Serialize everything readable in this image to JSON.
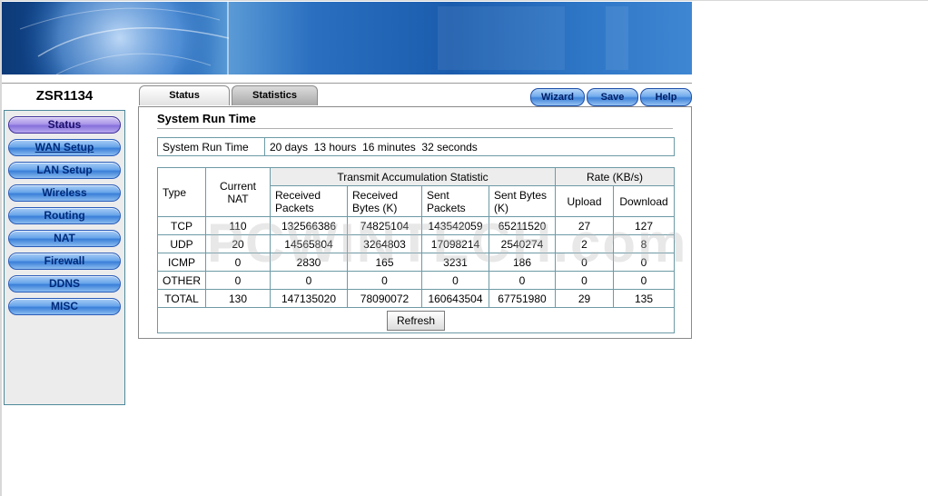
{
  "device_name": "ZSR1134",
  "sidebar": {
    "items": [
      {
        "label": "Status"
      },
      {
        "label": "WAN Setup"
      },
      {
        "label": "LAN Setup"
      },
      {
        "label": "Wireless"
      },
      {
        "label": "Routing"
      },
      {
        "label": "NAT"
      },
      {
        "label": "Firewall"
      },
      {
        "label": "DDNS"
      },
      {
        "label": "MISC"
      }
    ]
  },
  "tabs": [
    {
      "label": "Status"
    },
    {
      "label": "Statistics"
    }
  ],
  "actions": {
    "wizard": "Wizard",
    "save": "Save",
    "help": "Help"
  },
  "panel": {
    "title": "System Run Time",
    "run_time_label": "System Run Time",
    "run_time_value": "20 days  13 hours  16 minutes  32 seconds"
  },
  "stats": {
    "headers": {
      "type": "Type",
      "current_nat": "Current NAT",
      "transmit": "Transmit Accumulation Statistic",
      "rate": "Rate (KB/s)",
      "received_packets": "Received Packets",
      "received_bytes": "Received Bytes (K)",
      "sent_packets": "Sent Packets",
      "sent_bytes": "Sent Bytes (K)",
      "upload": "Upload",
      "download": "Download"
    },
    "rows": [
      {
        "type": "TCP",
        "nat": "110",
        "rx_pkts": "132566386",
        "rx_bytes": "74825104",
        "tx_pkts": "143542059",
        "tx_bytes": "65211520",
        "upload": "27",
        "download": "127"
      },
      {
        "type": "UDP",
        "nat": "20",
        "rx_pkts": "14565804",
        "rx_bytes": "3264803",
        "tx_pkts": "17098214",
        "tx_bytes": "2540274",
        "upload": "2",
        "download": "8"
      },
      {
        "type": "ICMP",
        "nat": "0",
        "rx_pkts": "2830",
        "rx_bytes": "165",
        "tx_pkts": "3231",
        "tx_bytes": "186",
        "upload": "0",
        "download": "0"
      },
      {
        "type": "OTHER",
        "nat": "0",
        "rx_pkts": "0",
        "rx_bytes": "0",
        "tx_pkts": "0",
        "tx_bytes": "0",
        "upload": "0",
        "download": "0"
      },
      {
        "type": "TOTAL",
        "nat": "130",
        "rx_pkts": "147135020",
        "rx_bytes": "78090072",
        "tx_pkts": "160643504",
        "tx_bytes": "67751980",
        "upload": "29",
        "download": "135"
      }
    ],
    "refresh_label": "Refresh"
  },
  "watermark": "PCWINTECH.com"
}
